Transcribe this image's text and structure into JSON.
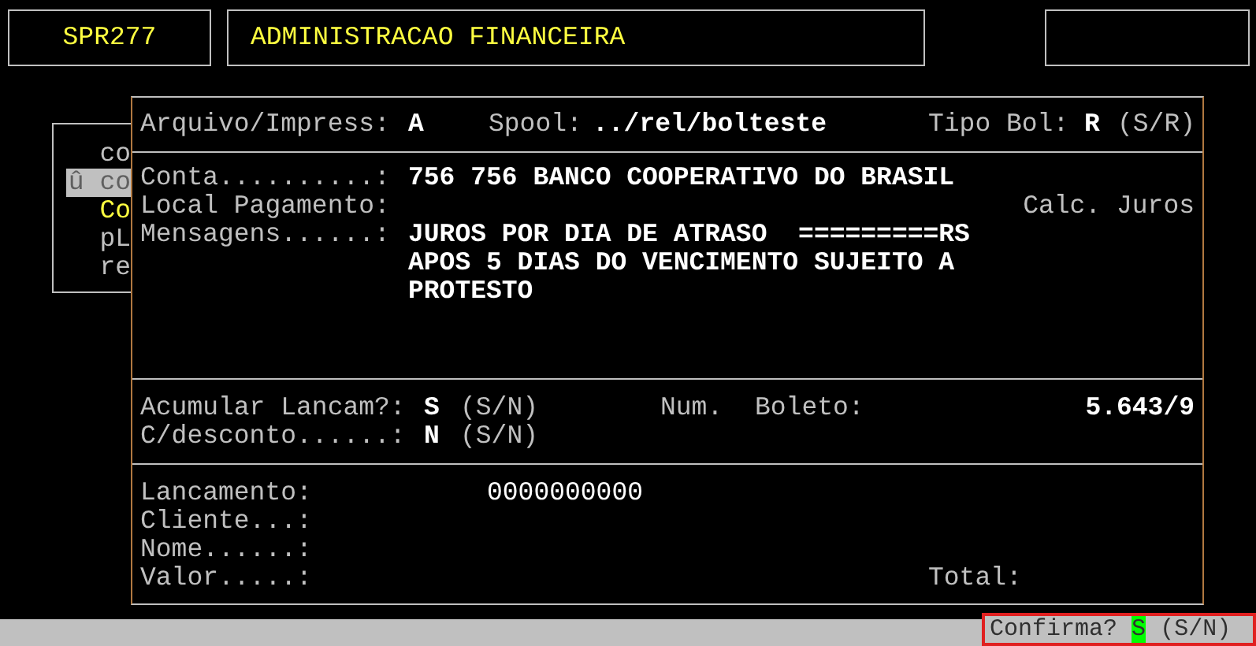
{
  "header": {
    "program": "SPR277",
    "title": "ADMINISTRACAO FINANCEIRA"
  },
  "side_menu": {
    "items": [
      {
        "label": "co",
        "selected": false,
        "kind": "normal"
      },
      {
        "label": "û co",
        "selected": true,
        "kind": "normal"
      },
      {
        "label": "Co",
        "selected": false,
        "kind": "highlighted"
      },
      {
        "label": "pL",
        "selected": false,
        "kind": "normal"
      },
      {
        "label": "re",
        "selected": false,
        "kind": "normal"
      }
    ]
  },
  "print_options": {
    "file_label": "Arquivo/Impress:",
    "file_value": "A",
    "spool_label": "Spool:",
    "spool_value": "../rel/bolteste",
    "type_label": "Tipo Bol:",
    "type_value": "R",
    "type_hint": "(S/R)"
  },
  "account": {
    "conta_label": "Conta..........:",
    "conta_value": "756 756 BANCO COOPERATIVO DO BRASIL",
    "local_label": "Local Pagamento:",
    "calc_label": "Calc. Juros",
    "messages_label": "Mensagens......:",
    "messages": [
      "JUROS POR DIA DE ATRASO  =========RS",
      "APOS 5 DIAS DO VENCIMENTO SUJEITO A",
      "PROTESTO"
    ]
  },
  "options": {
    "acumular_label": "Acumular Lancam?:",
    "acumular_value": "S",
    "acumular_hint": "(S/N)",
    "desconto_label": "C/desconto......:",
    "desconto_value": "N",
    "desconto_hint": "(S/N)",
    "num_label": "Num.",
    "boleto_label": "Boleto:",
    "boleto_value": "5.643/9"
  },
  "entry": {
    "lancamento_label": "Lancamento:",
    "lancamento_value": "0000000000",
    "fields": [
      "Cliente...:",
      "Nome......:",
      "Valor.....:"
    ],
    "total_label": "Total:"
  },
  "prompt": {
    "label": "Confirma?",
    "value": "S",
    "hint": "(S/N)"
  }
}
